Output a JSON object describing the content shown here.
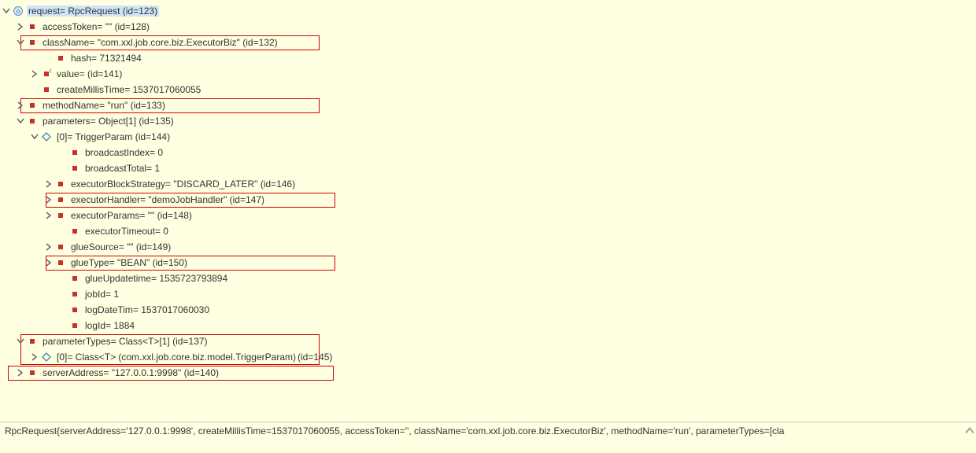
{
  "tree": {
    "root": "request= RpcRequest  (id=123)",
    "accessToken": "accessToken= \"\"  (id=128)",
    "className": "className= \"com.xxl.job.core.biz.ExecutorBiz\"  (id=132)",
    "hash": "hash= 71321494",
    "value": "value=  (id=141)",
    "createMillisTime": "createMillisTime= 1537017060055",
    "methodName": "methodName= \"run\"  (id=133)",
    "parameters": "parameters= Object[1]  (id=135)",
    "p0": "[0]= TriggerParam  (id=144)",
    "broadcastIndex": "broadcastIndex= 0",
    "broadcastTotal": "broadcastTotal= 1",
    "executorBlockStrategy": "executorBlockStrategy= \"DISCARD_LATER\"  (id=146)",
    "executorHandler": "executorHandler= \"demoJobHandler\"  (id=147)",
    "executorParams": "executorParams= \"\"  (id=148)",
    "executorTimeout": "executorTimeout= 0",
    "glueSource": "glueSource= \"\"  (id=149)",
    "glueType": "glueType= \"BEAN\"  (id=150)",
    "glueUpdatetime": "glueUpdatetime= 1535723793894",
    "jobId": "jobId= 1",
    "logDateTim": "logDateTim= 1537017060030",
    "logId": "logId= 1884",
    "parameterTypes": "parameterTypes= Class<T>[1]  (id=137)",
    "pt0": "[0]= Class<T> (com.xxl.job.core.biz.model.TriggerParam)",
    "pt0_suffix": " (id=145)",
    "serverAddress": "serverAddress= \"127.0.0.1:9998\"  (id=140)"
  },
  "footer": "RpcRequest{serverAddress='127.0.0.1:9998', createMillisTime=1537017060055, accessToken='', className='com.xxl.job.core.biz.ExecutorBiz', methodName='run', parameterTypes=[cla"
}
